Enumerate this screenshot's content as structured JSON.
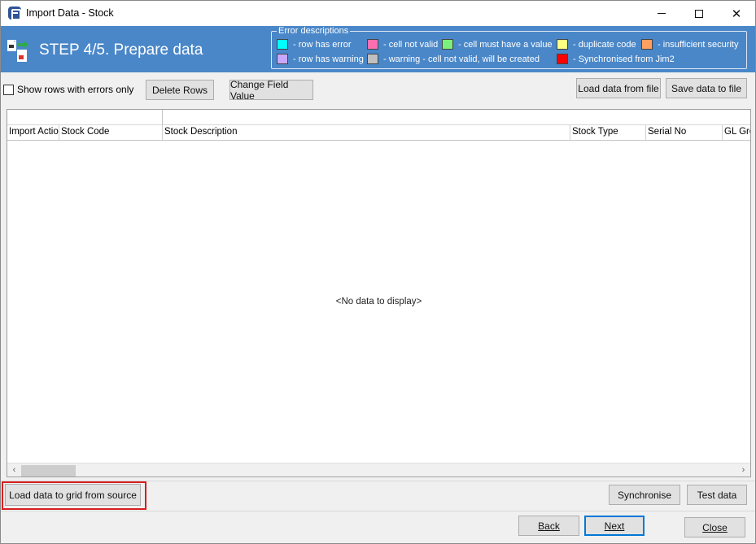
{
  "window": {
    "title": "Import Data - Stock"
  },
  "banner": {
    "step_title": "STEP 4/5. Prepare data",
    "error_legend_title": "Error descriptions",
    "errors": [
      {
        "color": "#00ffff",
        "label": "- row has error"
      },
      {
        "color": "#ff6fb0",
        "label": "- cell not valid"
      },
      {
        "color": "#7cf07c",
        "label": "- cell must have a value"
      },
      {
        "color": "#ffff80",
        "label": "- duplicate code"
      },
      {
        "color": "#ffa060",
        "label": "- insufficient security"
      },
      {
        "color": "#c8a8ff",
        "label": "- row has warning"
      },
      {
        "color": "#c0c0c0",
        "label": "- warning - cell not valid, will be created"
      },
      {
        "color": "#ff0000",
        "label": "- Synchronised from Jim2"
      }
    ]
  },
  "toolbar": {
    "show_errors_label": "Show rows with errors only",
    "show_errors_checked": false,
    "delete_rows": "Delete Rows",
    "change_field_value": "Change Field Value",
    "load_from_file": "Load data from file",
    "save_to_file": "Save data to file"
  },
  "grid": {
    "columns": [
      "Import Action",
      "Stock Code",
      "Stock Description",
      "Stock Type",
      "Serial No",
      "GL Gro"
    ],
    "empty_text": "<No data to display>"
  },
  "bottom": {
    "load_from_source": "Load data to grid from source",
    "synchronise": "Synchronise",
    "test_data": "Test data",
    "back": "Back",
    "next": "Next",
    "close": "Close"
  }
}
